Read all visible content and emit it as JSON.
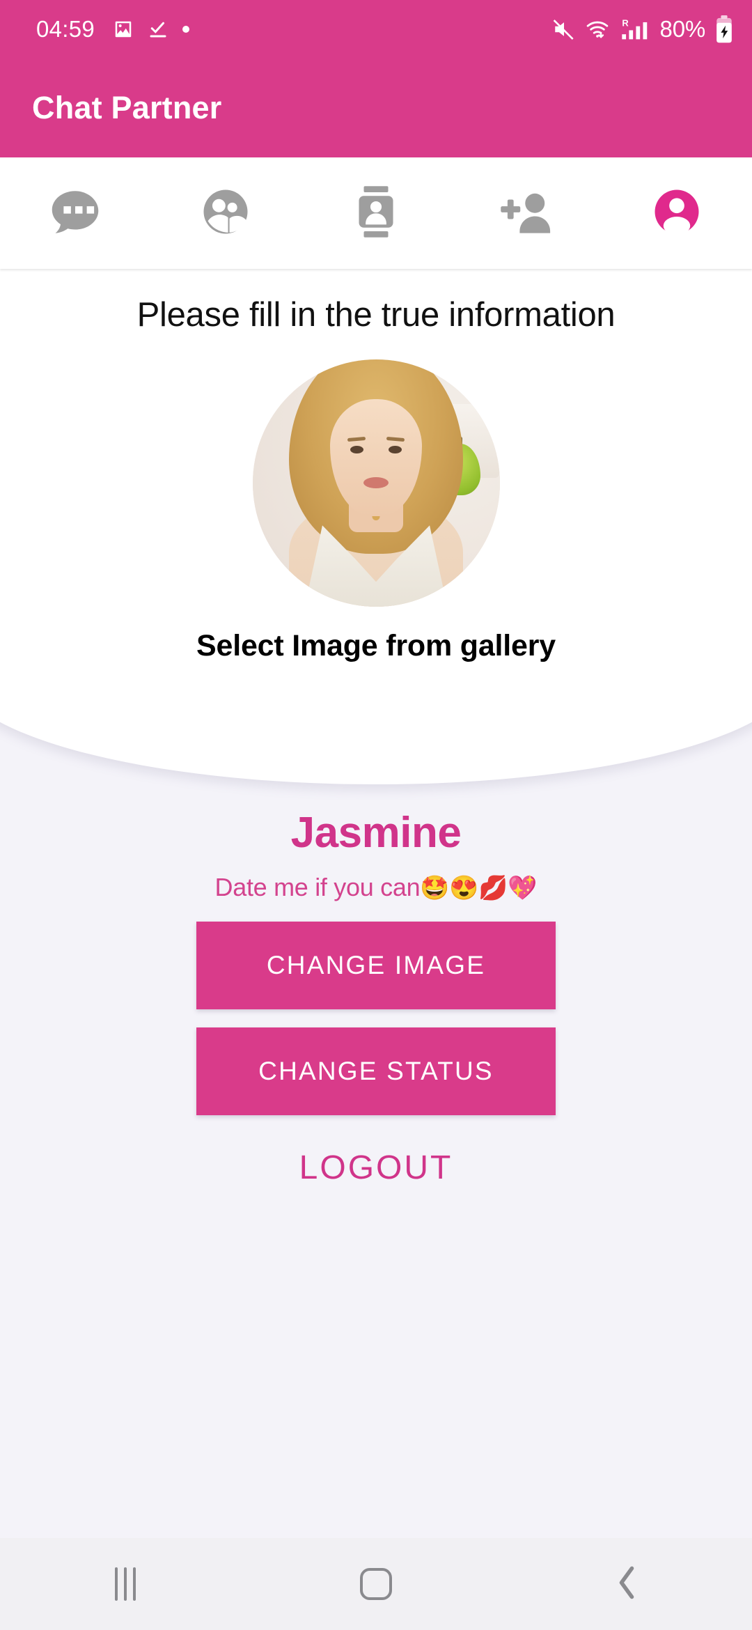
{
  "status_bar": {
    "time": "04:59",
    "left_icons": [
      {
        "name": "image-icon",
        "glyph": "ὛC"
      },
      {
        "name": "check-download-icon",
        "glyph": "check"
      },
      {
        "name": "dot-indicator-icon",
        "glyph": "•"
      }
    ],
    "right_icons": [
      {
        "name": "mute-icon"
      },
      {
        "name": "wifi-icon"
      },
      {
        "name": "roaming-signal-icon",
        "label": "R"
      },
      {
        "name": "battery-charging-icon"
      }
    ],
    "battery_text": "80%"
  },
  "app_bar": {
    "title": "Chat Partner"
  },
  "tabs": [
    {
      "name": "tab-chats",
      "icon": "chat-bubble-icon",
      "active": false
    },
    {
      "name": "tab-groups",
      "icon": "group-people-icon",
      "active": false
    },
    {
      "name": "tab-contacts",
      "icon": "contact-card-icon",
      "active": false
    },
    {
      "name": "tab-add-friend",
      "icon": "person-add-icon",
      "active": false
    },
    {
      "name": "tab-profile",
      "icon": "person-circle-icon",
      "active": true
    }
  ],
  "card": {
    "heading": "Please fill in the true information",
    "avatar_alt": "profile-photo",
    "gallery_label": "Select Image from gallery"
  },
  "profile": {
    "username": "Jasmine",
    "status_text": "Date me if you can",
    "status_emoji": "🤩😍💋💖",
    "change_image_label": "CHANGE IMAGE",
    "change_status_label": "CHANGE STATUS",
    "logout_label": "LOGOUT"
  },
  "nav_bar": {
    "recents_label": "recents-button",
    "home_label": "home-button",
    "back_label": "back-button"
  },
  "colors": {
    "brand_pink": "#D93B8A",
    "accent_pink": "#D0348A",
    "page_bg": "#F4F3F9",
    "card_bg": "#FFFFFF",
    "tab_inactive": "#9E9E9E",
    "nav_bg": "#F1F0F3"
  }
}
